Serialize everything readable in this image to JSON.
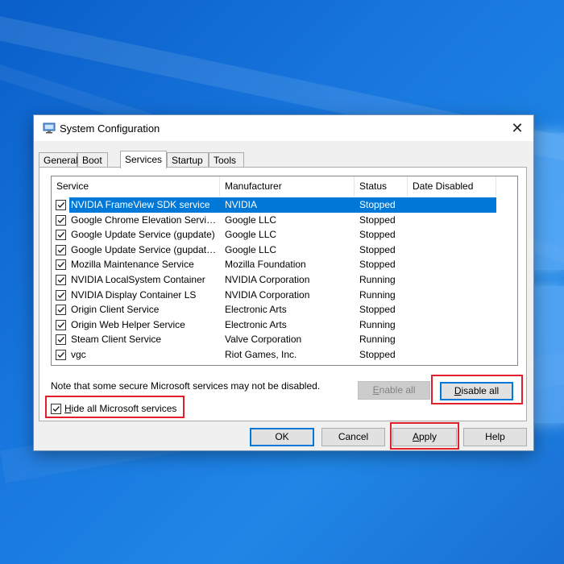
{
  "window": {
    "title": "System Configuration",
    "close_glyph": "✕"
  },
  "tabs": [
    {
      "label": "General"
    },
    {
      "label": "Boot"
    },
    {
      "label": "Services"
    },
    {
      "label": "Startup"
    },
    {
      "label": "Tools"
    }
  ],
  "active_tab": "Services",
  "services_table": {
    "columns": [
      "Service",
      "Manufacturer",
      "Status",
      "Date Disabled"
    ],
    "rows": [
      {
        "service": "NVIDIA FrameView SDK service",
        "manufacturer": "NVIDIA",
        "status": "Stopped",
        "date_disabled": "",
        "checked": true,
        "selected": true
      },
      {
        "service": "Google Chrome Elevation Servic...",
        "manufacturer": "Google LLC",
        "status": "Stopped",
        "date_disabled": "",
        "checked": true,
        "selected": false
      },
      {
        "service": "Google Update Service (gupdate)",
        "manufacturer": "Google LLC",
        "status": "Stopped",
        "date_disabled": "",
        "checked": true,
        "selected": false
      },
      {
        "service": "Google Update Service (gupdatem)",
        "manufacturer": "Google LLC",
        "status": "Stopped",
        "date_disabled": "",
        "checked": true,
        "selected": false
      },
      {
        "service": "Mozilla Maintenance Service",
        "manufacturer": "Mozilla Foundation",
        "status": "Stopped",
        "date_disabled": "",
        "checked": true,
        "selected": false
      },
      {
        "service": "NVIDIA LocalSystem Container",
        "manufacturer": "NVIDIA Corporation",
        "status": "Running",
        "date_disabled": "",
        "checked": true,
        "selected": false
      },
      {
        "service": "NVIDIA Display Container LS",
        "manufacturer": "NVIDIA Corporation",
        "status": "Running",
        "date_disabled": "",
        "checked": true,
        "selected": false
      },
      {
        "service": "Origin Client Service",
        "manufacturer": "Electronic Arts",
        "status": "Stopped",
        "date_disabled": "",
        "checked": true,
        "selected": false
      },
      {
        "service": "Origin Web Helper Service",
        "manufacturer": "Electronic Arts",
        "status": "Running",
        "date_disabled": "",
        "checked": true,
        "selected": false
      },
      {
        "service": "Steam Client Service",
        "manufacturer": "Valve Corporation",
        "status": "Running",
        "date_disabled": "",
        "checked": true,
        "selected": false
      },
      {
        "service": "vgc",
        "manufacturer": "Riot Games, Inc.",
        "status": "Stopped",
        "date_disabled": "",
        "checked": true,
        "selected": false
      }
    ]
  },
  "note": "Note that some secure Microsoft services may not be disabled.",
  "enable_all": {
    "mnemonic": "E",
    "rest": "nable all",
    "enabled": false
  },
  "disable_all": {
    "mnemonic": "D",
    "rest": "isable all",
    "enabled": true
  },
  "hide_ms": {
    "mnemonic": "H",
    "rest": "ide all Microsoft services",
    "checked": true
  },
  "buttons": {
    "ok": "OK",
    "cancel": "Cancel",
    "apply": {
      "mnemonic": "A",
      "rest": "pply"
    },
    "help": "Help"
  },
  "icons": {
    "app": "system-configuration-icon",
    "close": "close-icon",
    "checkbox": "checkmark-icon"
  },
  "colors": {
    "selection": "#0078d7",
    "highlight": "#e0202a",
    "desktop": "#1877de"
  }
}
